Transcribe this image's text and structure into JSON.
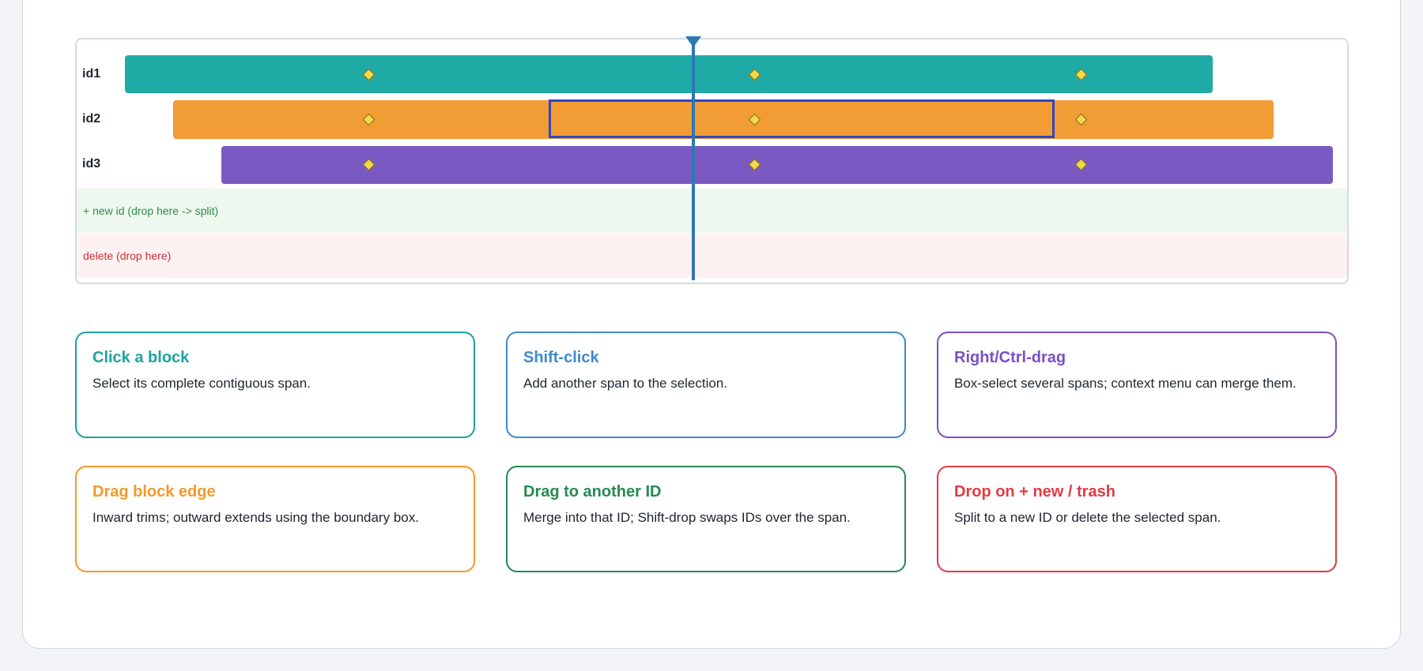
{
  "timeline": {
    "rows": [
      {
        "label": "id1",
        "color": "#20aaa6"
      },
      {
        "label": "id2",
        "color": "#f29c35"
      },
      {
        "label": "id3",
        "color": "#7b59c3"
      }
    ],
    "new_zone_label": "+ new id (drop here -> split)",
    "delete_zone_label": "delete (drop here)",
    "playhead_color": "#2d78b4",
    "selection_color": "#2e46c8"
  },
  "tips": [
    {
      "title": "Click a block",
      "text": "Select its complete contiguous span.",
      "color": "#1aa39f"
    },
    {
      "title": "Shift-click",
      "text": "Add another span to the selection.",
      "color": "#3d8ad0"
    },
    {
      "title": "Right/Ctrl-drag",
      "text": "Box-select several spans; context menu can merge them.",
      "color": "#7b4fc6"
    },
    {
      "title": "Drag block edge",
      "text": "Inward trims; outward extends using the boundary box.",
      "color": "#f39a28"
    },
    {
      "title": "Drag to another ID",
      "text": "Merge into that ID; Shift-drop swaps IDs over the span.",
      "color": "#258a52"
    },
    {
      "title": "Drop on + new / trash",
      "text": "Split to a new ID or delete the selected span.",
      "color": "#e03b43"
    }
  ]
}
